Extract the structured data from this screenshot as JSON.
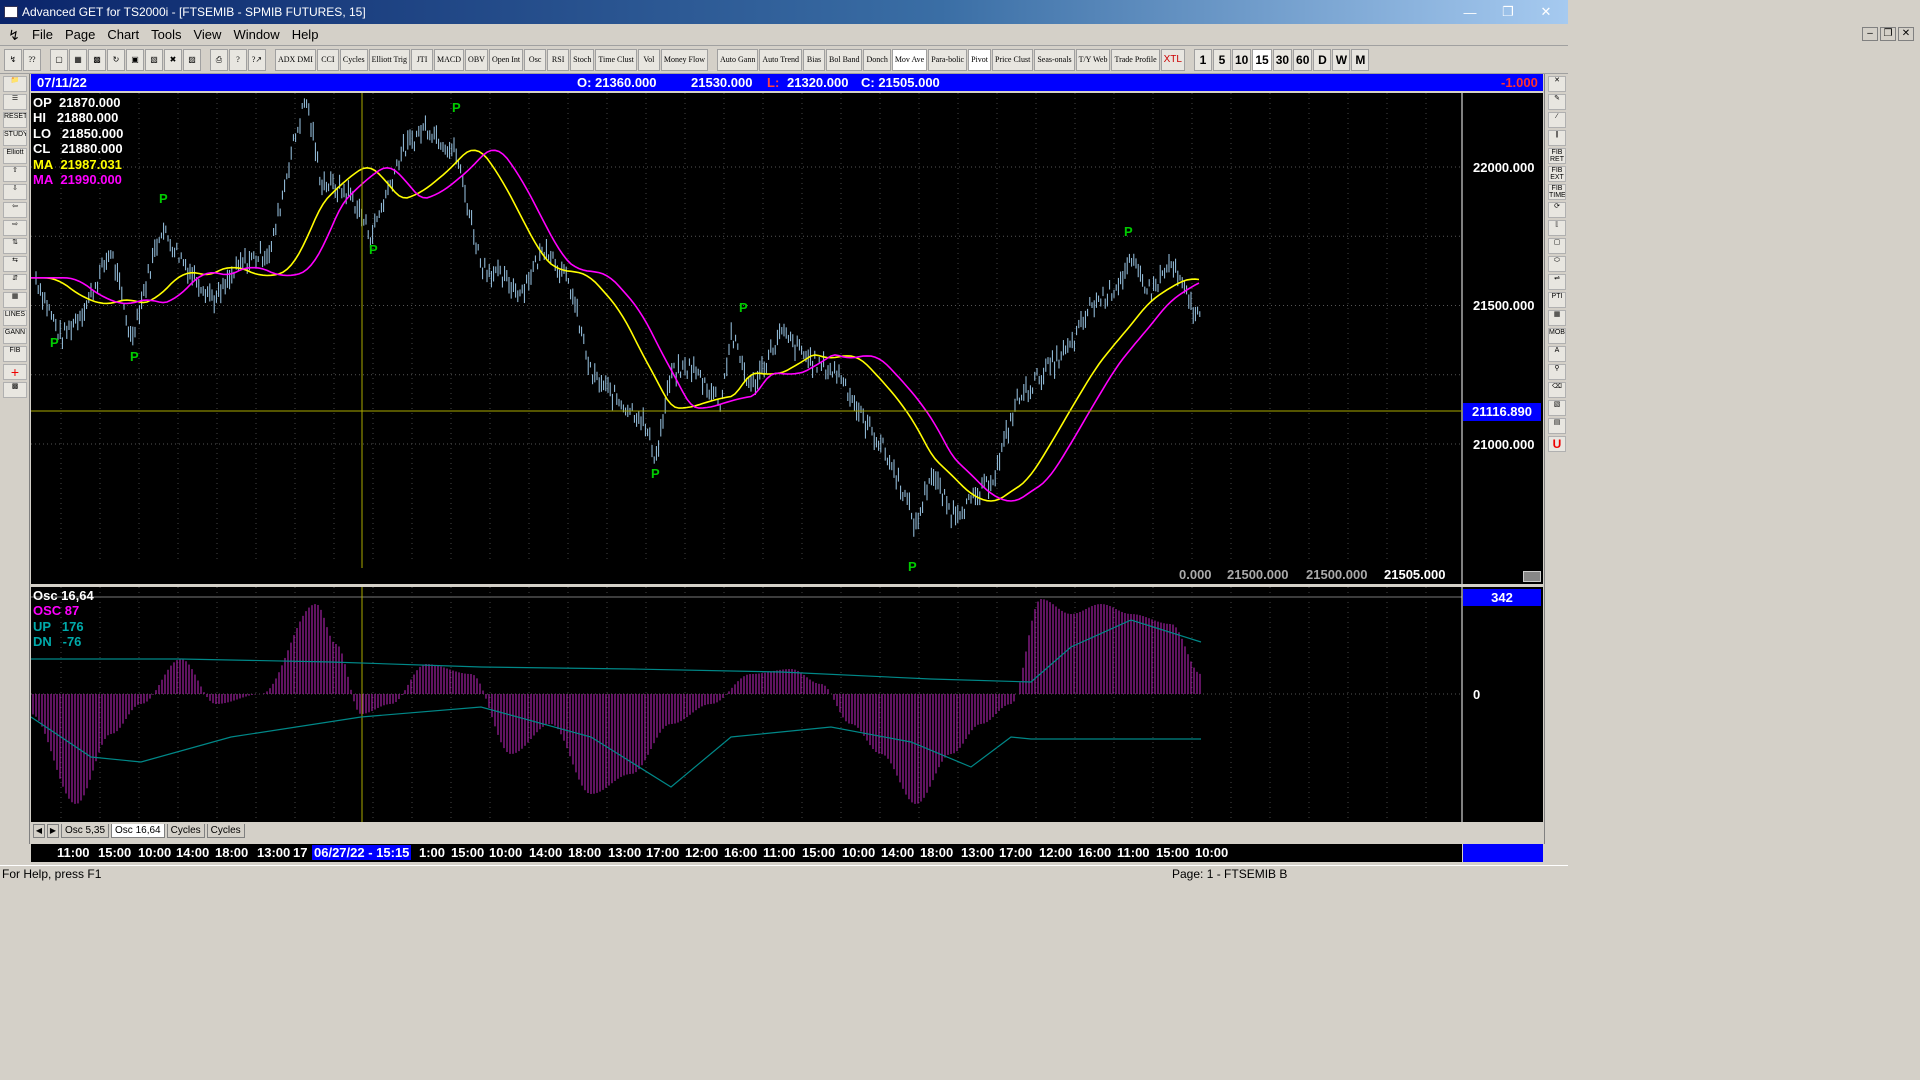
{
  "window": {
    "title": "Advanced GET for TS2000i - [FTSEMIB - SPMIB FUTURES, 15]",
    "controls": [
      "minimize",
      "restore",
      "close"
    ]
  },
  "menu": [
    "File",
    "Page",
    "Chart",
    "Tools",
    "View",
    "Window",
    "Help"
  ],
  "toolbar": {
    "studies": [
      "ADX DMI",
      "CCI",
      "Cycles",
      "Elliott Trig",
      "JTI",
      "MACD",
      "OBV",
      "Open Int",
      "Osc",
      "RSI",
      "Stoch",
      "Time Clust",
      "Vol",
      "Money Flow",
      "Auto Gann",
      "Auto Trend",
      "Bias",
      "Bol Band",
      "Donch",
      "Mov Ave",
      "Para-bolic",
      "Pivot",
      "Price Clust",
      "Seas-onals",
      "T/Y Web",
      "Trade Profile",
      "XTL"
    ],
    "periods": [
      "1",
      "5",
      "10",
      "15",
      "30",
      "60",
      "D",
      "W",
      "M"
    ],
    "selected_period": "15"
  },
  "info_bar": {
    "date": "07/11/22",
    "open": "O: 21360.000",
    "high": "21530.000",
    "low_label": "L:",
    "low": "21320.000",
    "close": "C: 21505.000",
    "change": "-1.000"
  },
  "price_panel": {
    "op": {
      "label": "OP",
      "value": "21870.000"
    },
    "hi": {
      "label": "HI",
      "value": "21880.000"
    },
    "lo": {
      "label": "LO",
      "value": "21850.000"
    },
    "cl": {
      "label": "CL",
      "value": "21880.000"
    },
    "ma1": {
      "label": "MA",
      "value": "21987.031",
      "color": "#ffff00"
    },
    "ma2": {
      "label": "MA",
      "value": "21990.000",
      "color": "#ff00ff"
    },
    "axis_ticks": [
      "22000.000",
      "21500.000",
      "21000.000"
    ],
    "cursor_price": "21116.890",
    "bottom_values": [
      "0.000",
      "21500.000",
      "21500.000",
      "21505.000"
    ],
    "pivot_marker": "P"
  },
  "osc_panel": {
    "title": "Osc 16,64",
    "osc": {
      "label": "OSC",
      "value": "87",
      "color": "#ff00ff"
    },
    "up": {
      "label": "UP",
      "value": "176",
      "color": "#00aaaa"
    },
    "dn": {
      "label": "DN",
      "value": "-76",
      "color": "#00aaaa"
    },
    "value_box": "342",
    "zero_label": "0"
  },
  "tabs": [
    "Osc 5,35",
    "Osc 16,64",
    "Cycles",
    "Cycles"
  ],
  "active_tab": "Osc 16,64",
  "time_axis": [
    "11:00",
    "15:00",
    "10:00",
    "14:00",
    "18:00",
    "13:00",
    "17",
    "06/27/22 - 15:15",
    "1:00",
    "15:00",
    "10:00",
    "14:00",
    "18:00",
    "13:00",
    "17:00",
    "12:00",
    "16:00",
    "11:00",
    "15:00",
    "10:00",
    "14:00",
    "18:00",
    "13:00",
    "17:00",
    "12:00",
    "16:00",
    "11:00",
    "15:00",
    "10:00"
  ],
  "status": {
    "help": "For Help, press F1",
    "page": "Page: 1 - FTSEMIB B"
  },
  "colors": {
    "background": "#000000",
    "price_bars": "#9cc8e8",
    "ma_fast": "#ffff00",
    "ma_slow": "#ff00ff",
    "pivot": "#00cc00",
    "crosshair": "#aaaa00",
    "osc_hist": "#a020a0",
    "osc_band": "#008888",
    "info_bar": "#0000ff"
  }
}
